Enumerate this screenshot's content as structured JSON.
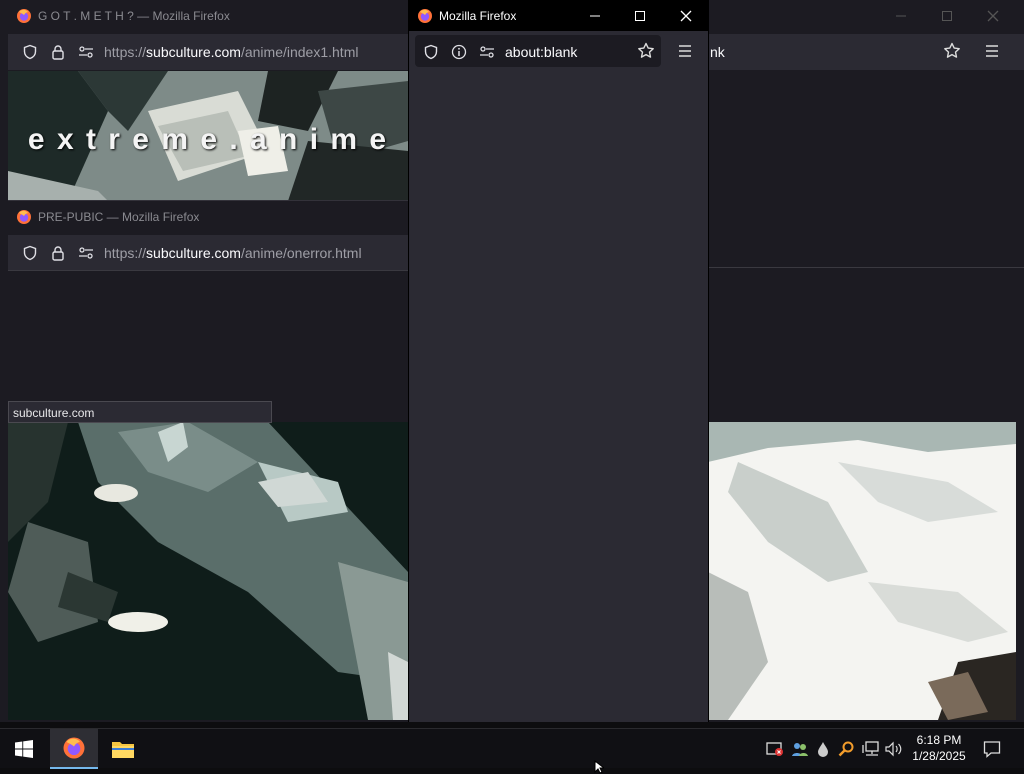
{
  "windows": {
    "back": {
      "title": "G O T . M E T H ? — Mozilla Firefox",
      "url_prefix": "https://",
      "url_domain": "subculture.com",
      "url_path": "/anime/index1.html",
      "banner_text": "e x t r e m e . a n i m e",
      "status_url": "subculture.com"
    },
    "middle": {
      "title": "PRE-PUBIC — Mozilla Firefox",
      "url_prefix": "https://",
      "url_domain": "subculture.com",
      "url_path": "/anime/onerror.html"
    },
    "front": {
      "title": "Mozilla Firefox",
      "url": "about:blank"
    },
    "right": {
      "url_fragment": "nk"
    }
  },
  "taskbar": {
    "clock_time": "6:18 PM",
    "clock_date": "1/28/2025"
  },
  "icons": [
    "firefox-icon",
    "shield-icon",
    "lock-icon",
    "permissions-icon",
    "info-icon",
    "star-icon",
    "menu-icon",
    "minimize-icon",
    "maximize-icon",
    "close-icon",
    "windows-start-icon",
    "folder-icon",
    "network-icon",
    "volume-icon",
    "notification-icon"
  ],
  "colors": {
    "accent_firefox": "#ff7139",
    "toolbar": "#2b2a33",
    "content": "#1c1b22"
  }
}
